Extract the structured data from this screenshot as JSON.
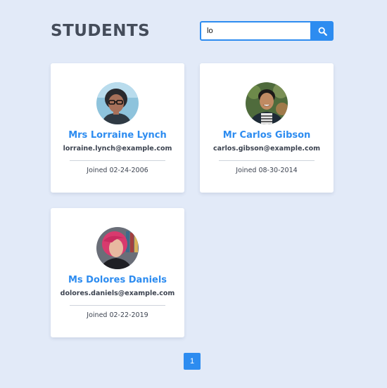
{
  "header": {
    "title": "STUDENTS"
  },
  "search": {
    "value": "lo",
    "icon": "search-icon"
  },
  "students": [
    {
      "name": "Mrs Lorraine Lynch",
      "email": "lorraine.lynch@example.com",
      "joined": "Joined 02-24-2006"
    },
    {
      "name": "Mr Carlos Gibson",
      "email": "carlos.gibson@example.com",
      "joined": "Joined 08-30-2014"
    },
    {
      "name": "Ms Dolores Daniels",
      "email": "dolores.daniels@example.com",
      "joined": "Joined 02-22-2019"
    }
  ],
  "pagination": {
    "current_page": "1"
  },
  "colors": {
    "accent": "#2d8cf0",
    "background": "#e2eaf8",
    "card": "#ffffff",
    "title": "#444c5a"
  }
}
